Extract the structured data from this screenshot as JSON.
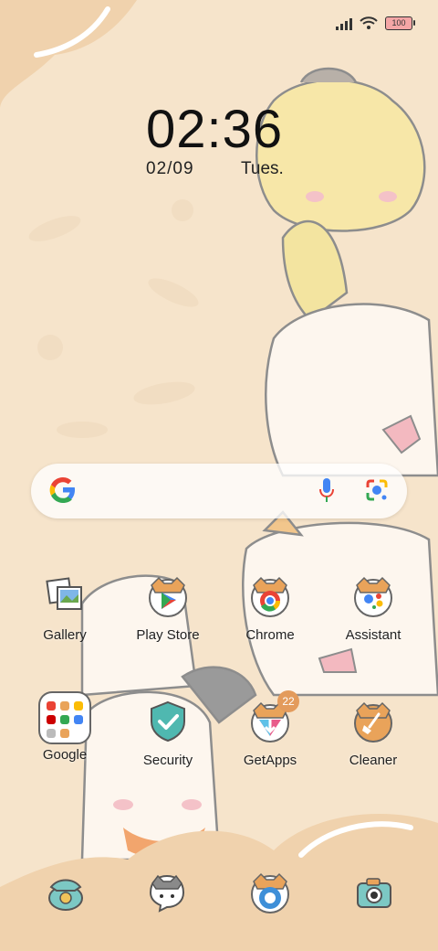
{
  "status_bar": {
    "signal_icon": "signal-icon",
    "wifi_icon": "wifi-icon",
    "battery_level": "100"
  },
  "clock": {
    "time": "02:36",
    "date": "02/09",
    "day": "Tues."
  },
  "search_bar": {
    "logo": "google-g-icon",
    "mic": "mic-icon",
    "lens": "lens-icon"
  },
  "apps_row1": [
    {
      "label": "Gallery"
    },
    {
      "label": "Play Store"
    },
    {
      "label": "Chrome"
    },
    {
      "label": "Assistant"
    }
  ],
  "apps_row2": [
    {
      "label": "Google"
    },
    {
      "label": "Security"
    },
    {
      "label": "GetApps",
      "badge": "22"
    },
    {
      "label": "Cleaner"
    }
  ],
  "dock": [
    {
      "icon": "phone-icon"
    },
    {
      "icon": "messages-icon"
    },
    {
      "icon": "browser-icon"
    },
    {
      "icon": "camera-icon"
    }
  ],
  "colors": {
    "background": "#f6e4cb",
    "cloud": "#f0d2ad",
    "badge": "#e39b5c"
  }
}
